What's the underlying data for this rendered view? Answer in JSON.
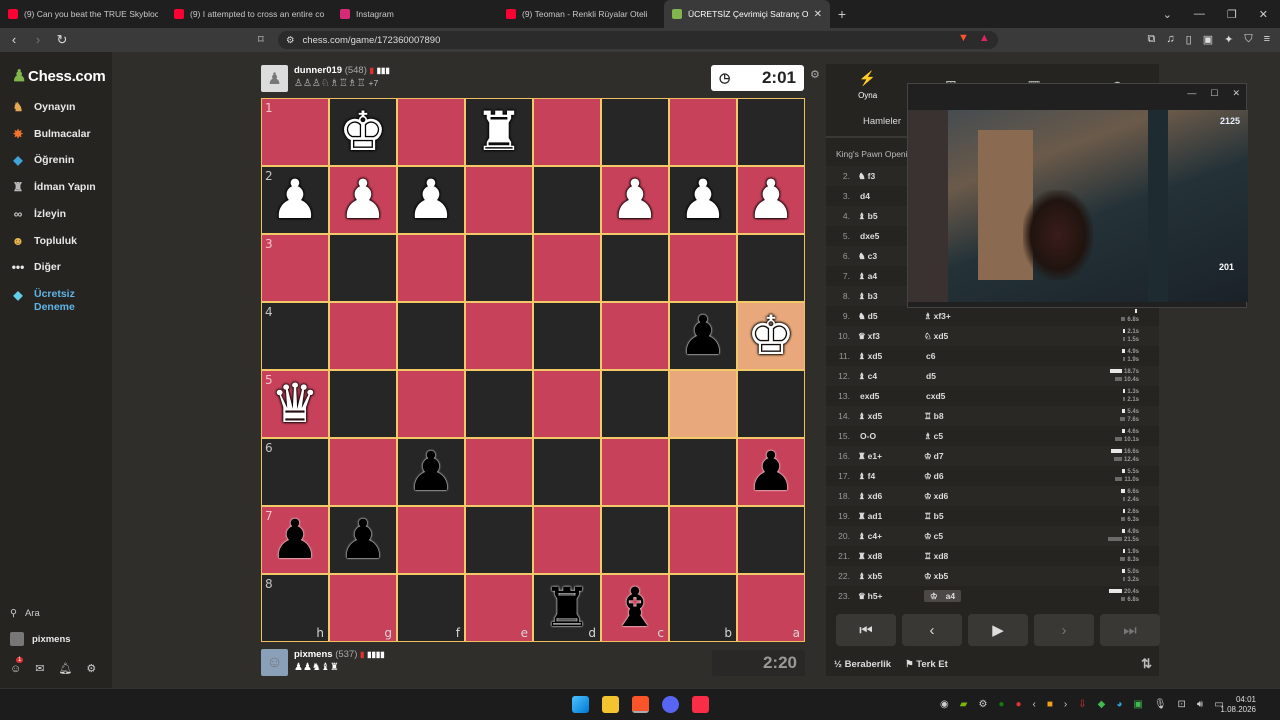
{
  "tabs": [
    {
      "title": "(9) Can you beat the TRUE Skyblock?",
      "color": "#ff0033"
    },
    {
      "title": "(9) I attempted to cross an entire co",
      "color": "#ff0033"
    },
    {
      "title": "Instagram",
      "color": "#d62976"
    },
    {
      "title": "(9) Teoman - Renkli Rüyalar Oteli",
      "color": "#ff0033"
    },
    {
      "title": "ÜCRETSİZ Çevrimiçi Satranç Oyn",
      "color": "#81b64c"
    }
  ],
  "url": "chess.com/game/172360007890",
  "sidebar": {
    "logo": "Chess.com",
    "items": [
      "Oynayın",
      "Bulmacalar",
      "Öğrenin",
      "İdman Yapın",
      "İzleyin",
      "Topluluk",
      "Diğer"
    ],
    "trial_line1": "Ücretsiz",
    "trial_line2": "Deneme",
    "search": "Ara",
    "user": "pixmens",
    "notif_count": "1"
  },
  "top_player": {
    "name": "dunner019",
    "rating": "(548)",
    "captured": "♙♙♙♘♗♖♗♖",
    "diff": "+7",
    "clock": "2:01"
  },
  "bottom_player": {
    "name": "pixmens",
    "rating": "(537)",
    "captured": "♟♟♞♝♜",
    "clock": "2:20"
  },
  "board": {
    "rank_labels": [
      "1",
      "2",
      "3",
      "4",
      "5",
      "6",
      "7",
      "8"
    ],
    "file_labels": [
      "h",
      "g",
      "f",
      "e",
      "d",
      "c",
      "b",
      "a"
    ],
    "pieces": {
      "0,1": "♚w",
      "0,3": "♜w",
      "1,0": "♟w",
      "1,1": "♟w",
      "1,2": "♟w",
      "1,5": "♟w",
      "1,6": "♟w",
      "1,7": "♟w",
      "3,6": "♟b",
      "3,7": "♚w",
      "4,0": "♛w",
      "5,2": "♟b",
      "5,7": "♟b",
      "6,0": "♟b",
      "6,1": "♟b",
      "7,4": "♜b",
      "7,5": "♝b"
    },
    "highlights": [
      "3,7",
      "4,6"
    ]
  },
  "panel": {
    "tabs": [
      "Oyna",
      "",
      "",
      ""
    ],
    "moves_tab": "Hamleler",
    "opening": "King's Pawn Openi",
    "moves": [
      {
        "n": "2.",
        "w": "f3",
        "wi": "♞",
        "b": "",
        "bi": "",
        "t": [
          "",
          ""
        ]
      },
      {
        "n": "3.",
        "w": "d4",
        "wi": "",
        "b": "",
        "bi": "",
        "t": [
          "",
          ""
        ]
      },
      {
        "n": "4.",
        "w": "b5",
        "wi": "♝",
        "b": "",
        "bi": "",
        "t": [
          "",
          ""
        ]
      },
      {
        "n": "5.",
        "w": "dxe5",
        "wi": "",
        "b": "",
        "bi": "",
        "t": [
          "",
          ""
        ]
      },
      {
        "n": "6.",
        "w": "c3",
        "wi": "♞",
        "b": "",
        "bi": "",
        "t": [
          "",
          ""
        ]
      },
      {
        "n": "7.",
        "w": "a4",
        "wi": "♝",
        "b": "",
        "bi": "",
        "t": [
          "",
          ""
        ]
      },
      {
        "n": "8.",
        "w": "b3",
        "wi": "♝",
        "b": "",
        "bi": "",
        "t": [
          "",
          ""
        ]
      },
      {
        "n": "9.",
        "w": "d5",
        "wi": "♞",
        "b": "xf3+",
        "bi": "♗",
        "t": [
          "",
          "6.8s"
        ]
      },
      {
        "n": "10.",
        "w": "xf3",
        "wi": "♛",
        "b": "xd5",
        "bi": "♘",
        "t": [
          "2.1s",
          "1.5s"
        ]
      },
      {
        "n": "11.",
        "w": "xd5",
        "wi": "♝",
        "b": "c6",
        "bi": "",
        "t": [
          "4.9s",
          "1.9s"
        ]
      },
      {
        "n": "12.",
        "w": "c4",
        "wi": "♝",
        "b": "d5",
        "bi": "",
        "t": [
          "18.7s",
          "10.4s"
        ]
      },
      {
        "n": "13.",
        "w": "exd5",
        "wi": "",
        "b": "cxd5",
        "bi": "",
        "t": [
          "1.3s",
          "2.1s"
        ]
      },
      {
        "n": "14.",
        "w": "xd5",
        "wi": "♝",
        "b": "b8",
        "bi": "♖",
        "t": [
          "5.4s",
          "7.6s"
        ]
      },
      {
        "n": "15.",
        "w": "O-O",
        "wi": "",
        "b": "c5",
        "bi": "♗",
        "t": [
          "4.6s",
          "10.1s"
        ]
      },
      {
        "n": "16.",
        "w": "e1+",
        "wi": "♜",
        "b": "d7",
        "bi": "♔",
        "t": [
          "16.6s",
          "12.4s"
        ]
      },
      {
        "n": "17.",
        "w": "f4",
        "wi": "♝",
        "b": "d6",
        "bi": "♔",
        "t": [
          "5.5s",
          "11.0s"
        ]
      },
      {
        "n": "18.",
        "w": "xd6",
        "wi": "♝",
        "b": "xd6",
        "bi": "♔",
        "t": [
          "6.6s",
          "2.4s"
        ]
      },
      {
        "n": "19.",
        "w": "ad1",
        "wi": "♜",
        "b": "b5",
        "bi": "♖",
        "t": [
          "2.6s",
          "6.3s"
        ]
      },
      {
        "n": "20.",
        "w": "c4+",
        "wi": "♝",
        "b": "c5",
        "bi": "♔",
        "t": [
          "4.9s",
          "21.5s"
        ]
      },
      {
        "n": "21.",
        "w": "xd8",
        "wi": "♜",
        "b": "xd8",
        "bi": "♖",
        "t": [
          "1.9s",
          "8.3s"
        ]
      },
      {
        "n": "22.",
        "w": "xb5",
        "wi": "♝",
        "b": "xb5",
        "bi": "♔",
        "t": [
          "5.0s",
          "3.2s"
        ]
      },
      {
        "n": "23.",
        "w": "h5+",
        "wi": "♛",
        "b": "a4",
        "bi": "♔",
        "t": [
          "20.4s",
          "6.8s"
        ]
      }
    ],
    "draw": "Beraberlik",
    "draw_prefix": "½",
    "resign": "Terk Et"
  },
  "video": {
    "hud_score": "2125",
    "hud_ammo": "201"
  },
  "clock": {
    "time": "04:01",
    "date": "1.08.2026"
  }
}
